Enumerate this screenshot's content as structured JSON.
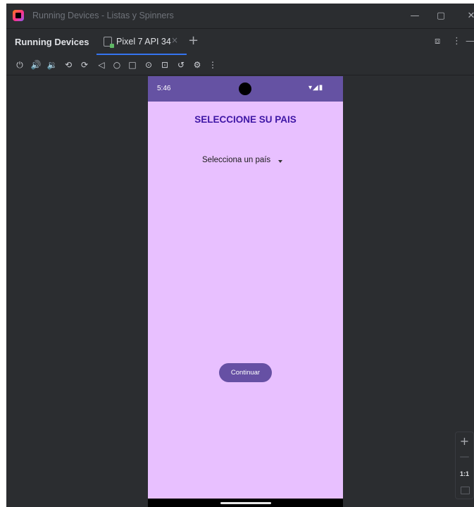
{
  "window": {
    "title": "Running Devices - Listas y Spinners",
    "icons": {
      "app": "android-studio-logo-icon",
      "minimize": "minimize-icon",
      "maximize": "maximize-icon",
      "close": "close-icon"
    },
    "minimize_glyph": "—",
    "maximize_glyph": "▢",
    "close_glyph": "✕"
  },
  "tool_window": {
    "title": "Running Devices",
    "tab": {
      "label": "Pixel 7 API 34",
      "close_glyph": "×",
      "icon": "device-icon"
    },
    "add_glyph": "+",
    "header_icons": [
      {
        "name": "restore-layout-icon",
        "glyph": "⧈"
      },
      {
        "name": "more-options-icon",
        "glyph": "⋮"
      },
      {
        "name": "hide-icon",
        "glyph": "—"
      }
    ]
  },
  "toolbar": {
    "buttons": [
      {
        "name": "power-icon",
        "glyph": "⏻"
      },
      {
        "name": "volume-up-icon",
        "glyph": "🔊"
      },
      {
        "name": "volume-down-icon",
        "glyph": "🔉"
      },
      {
        "name": "rotate-left-icon",
        "glyph": "⟲"
      },
      {
        "name": "rotate-right-icon",
        "glyph": "⟳"
      },
      {
        "name": "back-icon",
        "glyph": "◁"
      },
      {
        "name": "home-icon",
        "glyph": "○"
      },
      {
        "name": "overview-icon",
        "glyph": "□"
      },
      {
        "name": "screenshot-icon",
        "glyph": "⊙"
      },
      {
        "name": "screen-record-icon",
        "glyph": "⊡"
      },
      {
        "name": "reset-icon",
        "glyph": "↺"
      },
      {
        "name": "device-settings-icon",
        "glyph": "⚙"
      },
      {
        "name": "more-actions-icon",
        "glyph": "⋮"
      }
    ]
  },
  "device": {
    "status_bar": {
      "time": "5:46",
      "icons": "▾◢▮",
      "colors": {
        "bar": "#6552a3"
      }
    },
    "screen": {
      "title": "SELECCIONE SU PAIS",
      "spinner_selected": "Selecciona un país",
      "continue_label": "Continuar",
      "colors": {
        "background": "#e8c0ff",
        "title": "#3e16a5",
        "button": "#6650a4"
      }
    }
  },
  "zoom": {
    "zoom_in": "+",
    "zoom_out": "—",
    "actual_size": "1:1"
  }
}
